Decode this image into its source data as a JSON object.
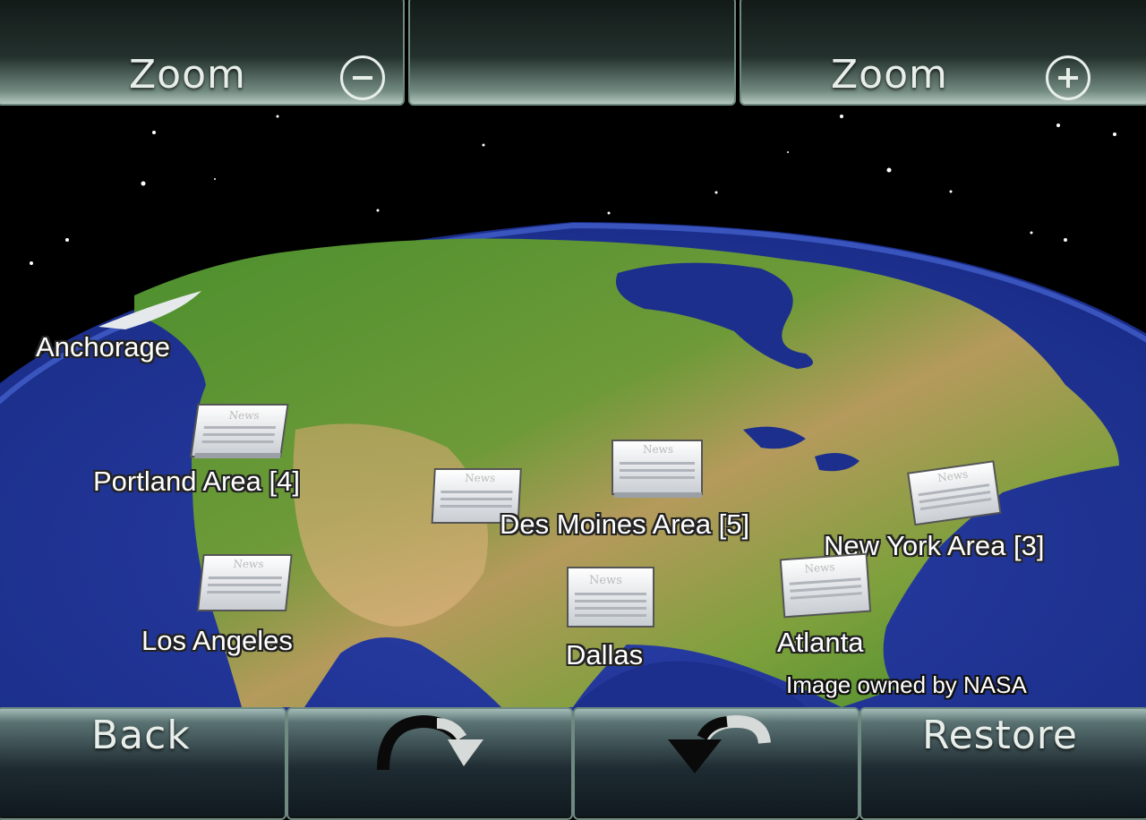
{
  "top_bar": {
    "zoom_out": {
      "label": "Zoom",
      "icon": "minus-circle-icon"
    },
    "zoom_in": {
      "label": "Zoom",
      "icon": "plus-circle-icon"
    }
  },
  "map": {
    "places": [
      {
        "label": "Anchorage",
        "icon": "pin-flag-icon"
      },
      {
        "label": "Portland Area [4]",
        "icon": "newspaper-icon"
      },
      {
        "label": "Des Moines Area [5]",
        "icon": "newspaper-icon"
      },
      {
        "label": "New York Area [3]",
        "icon": "newspaper-icon"
      },
      {
        "label": "Los Angeles",
        "icon": "newspaper-icon"
      },
      {
        "label": "Dallas",
        "icon": "newspaper-icon"
      },
      {
        "label": "Atlanta",
        "icon": "newspaper-icon"
      }
    ],
    "news_icon_text": "News",
    "credit": "Image owned by NASA"
  },
  "bottom_bar": {
    "back_label": "Back",
    "rotate_right_icon": "rotate-clockwise-icon",
    "rotate_left_icon": "rotate-counterclockwise-icon",
    "restore_label": "Restore"
  },
  "colors": {
    "space": "#000000",
    "ocean": "#1d2f8a",
    "land_green": "#3f8a2a",
    "land_desert": "#b8a060",
    "button_text": "#e8eee9"
  }
}
